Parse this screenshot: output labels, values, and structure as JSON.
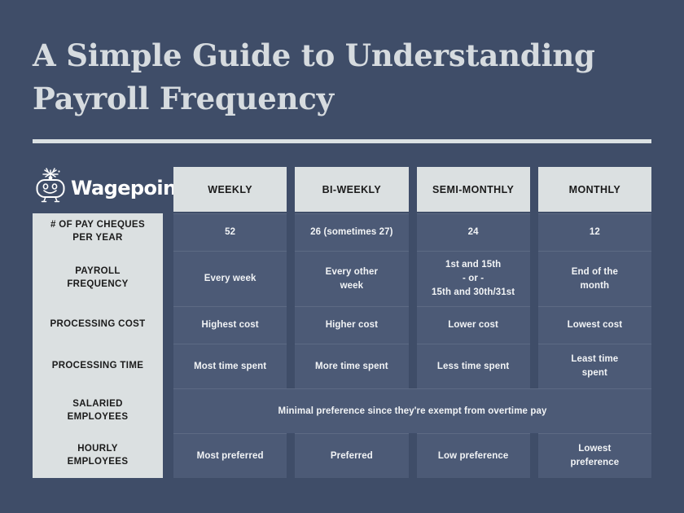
{
  "title": "A Simple Guide to Understanding\nPayroll Frequency",
  "brand": {
    "name": "Wagepoint",
    "logo_icon": "wagepoint-robot-icon"
  },
  "colors": {
    "background": "#3f4d68",
    "panel": "#dbe0e1",
    "cell": "#4c5a76",
    "title_text": "#d6dbdf",
    "cell_text": "#f2f4f6",
    "label_text": "#1b1b1b"
  },
  "table": {
    "columns": [
      "WEEKLY",
      "BI-WEEKLY",
      "SEMI-MONTHLY",
      "MONTHLY"
    ],
    "rows": [
      {
        "label": "# OF PAY CHEQUES\nPER YEAR",
        "merged": false,
        "cells": [
          "52",
          "26 (sometimes 27)",
          "24",
          "12"
        ]
      },
      {
        "label": "PAYROLL\nFREQUENCY",
        "merged": false,
        "cells": [
          "Every week",
          "Every other\nweek",
          "1st and 15th\n- or -\n15th and 30th/31st",
          "End of the\nmonth"
        ]
      },
      {
        "label": "PROCESSING COST",
        "merged": false,
        "cells": [
          "Highest cost",
          "Higher cost",
          "Lower cost",
          "Lowest cost"
        ]
      },
      {
        "label": "PROCESSING TIME",
        "merged": false,
        "cells": [
          "Most time spent",
          "More time spent",
          "Less time spent",
          "Least time\nspent"
        ]
      },
      {
        "label": "SALARIED\nEMPLOYEES",
        "merged": true,
        "merged_text": "Minimal preference since they're exempt from overtime pay",
        "cells": []
      },
      {
        "label": "HOURLY\nEMPLOYEES",
        "merged": false,
        "cells": [
          "Most preferred",
          "Preferred",
          "Low preference",
          "Lowest\npreference"
        ]
      }
    ]
  }
}
